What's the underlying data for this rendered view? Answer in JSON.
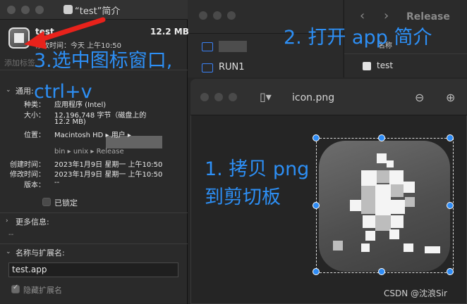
{
  "info_window": {
    "title": "“test”简介",
    "file_name": "test",
    "file_size": "12.2 MB",
    "modified_line": "修改时间：今天 上午10:50",
    "tags_placeholder": "添加标签",
    "general_section": {
      "header": "通用:",
      "rows": [
        {
          "key": "种类：",
          "value": "应用程序 (Intel)"
        },
        {
          "key": "大小：",
          "value": "12,196,748 字节（磁盘上的"
        },
        {
          "key": "",
          "value": "12.2 MB)"
        },
        {
          "key": "位置：",
          "value": "Macintosh HD ▸ 用户 ▸"
        },
        {
          "key": "",
          "value": "bin ▸ unix ▸ Release"
        },
        {
          "key": "创建时间：",
          "value": "2023年1月9日 星期一 上午10:50"
        },
        {
          "key": "修改时间：",
          "value": "2023年1月9日 星期一 上午10:50"
        },
        {
          "key": "版本：",
          "value": "--"
        }
      ],
      "locked_label": "已锁定"
    },
    "more_info": {
      "header": "更多信息:",
      "value": "--"
    },
    "name_ext": {
      "header": "名称与扩展名:",
      "name_value": "test.app",
      "hide_ext_label": "隐藏扩展名"
    }
  },
  "finder_bg": {
    "sidebar_rows": [
      "RUN1"
    ],
    "release_title": "Release",
    "column_header": "名称",
    "file_row": "test"
  },
  "preview_window": {
    "title": "icon.png"
  },
  "annotations": {
    "step1_line1": "1. 拷贝 png",
    "step1_line2": "到剪切板",
    "step2": "2. 打开 app 简介",
    "step3_line1": "3.选中图标窗口,",
    "step3_line2": "ctrl+v"
  },
  "watermark": "CSDN @沈浪Sir",
  "colors": {
    "annotation": "#2d8ff5",
    "arrow": "#e8221b",
    "handle": "#2f8cf5"
  }
}
